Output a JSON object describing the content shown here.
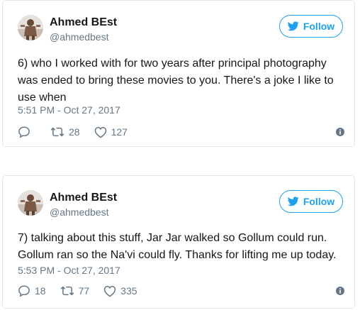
{
  "tweets": [
    {
      "author_name": "Ahmed BEst",
      "author_handle": "@ahmedbest",
      "follow_label": "Follow",
      "text": "6) who I worked with for two years after principal photography\nwas ended to bring these movies to you. There's a joke I like to\nuse when",
      "timestamp": "5:51 PM - Oct 27, 2017",
      "reply_count": "",
      "retweet_count": "28",
      "like_count": "127"
    },
    {
      "author_name": "Ahmed BEst",
      "author_handle": "@ahmedbest",
      "follow_label": "Follow",
      "text": "7) talking about this stuff, Jar Jar walked so Gollum could run.\nGollum ran so the Na'vi could fly. Thanks for lifting me up today.",
      "timestamp": "5:53 PM - Oct 27, 2017",
      "reply_count": "18",
      "retweet_count": "77",
      "like_count": "335"
    }
  ],
  "colors": {
    "brand_blue": "#1da1f2",
    "text_primary": "#14171a",
    "text_secondary": "#657786",
    "border": "#e1e8ed"
  },
  "icons": {
    "follow": "twitter-bird-icon",
    "reply": "reply-icon",
    "retweet": "retweet-icon",
    "like": "heart-icon",
    "info": "info-icon"
  }
}
